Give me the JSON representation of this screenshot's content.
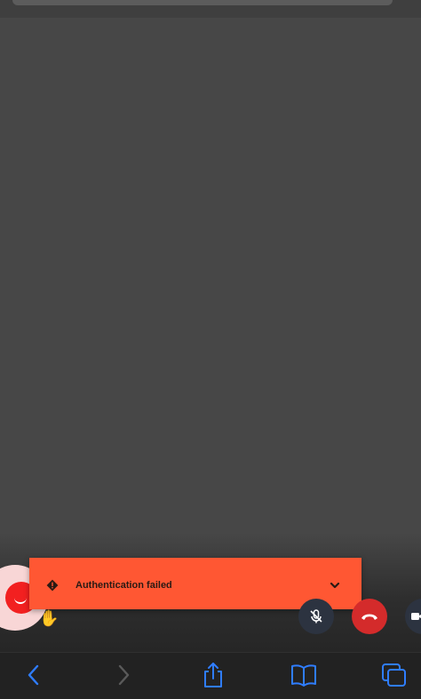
{
  "toast": {
    "message": "Authentication failed",
    "icon": "warning-diamond-icon",
    "expand_icon": "chevron-down-icon",
    "color": "#ff5733"
  },
  "call_controls": {
    "chat_icon": "chat-bubble-icon",
    "raise_hand_icon": "raise-hand-icon",
    "mic_icon": "microphone-muted-icon",
    "hangup_icon": "phone-hangup-icon",
    "camera_icon": "video-camera-icon",
    "hangup_color": "#d42b2b"
  },
  "browser_toolbar": {
    "buttons": [
      "back-icon",
      "forward-icon",
      "share-icon",
      "bookmarks-icon",
      "tabs-icon"
    ],
    "accent": "#2f7dff"
  }
}
